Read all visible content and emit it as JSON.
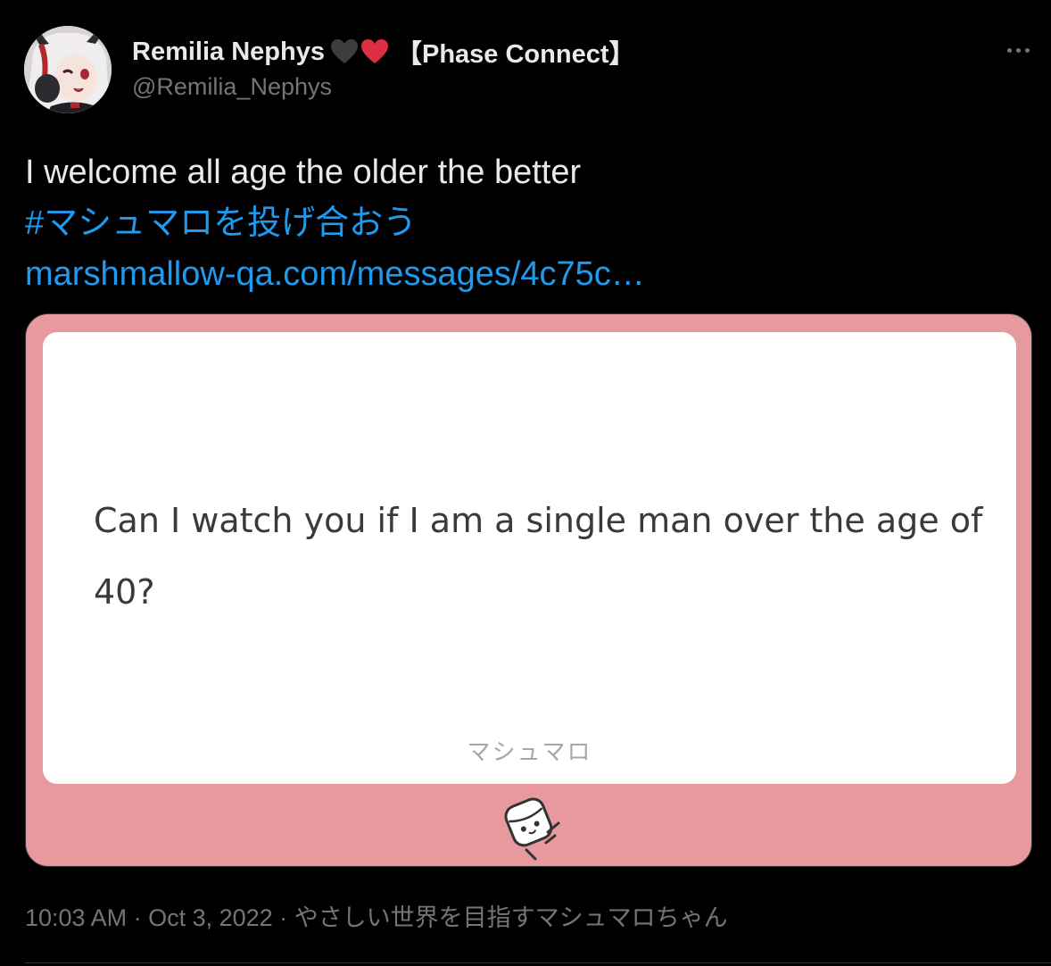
{
  "author": {
    "display_name": "Remilia Nephys",
    "badge_emojis": [
      "black-heart-icon",
      "red-heart-icon"
    ],
    "tag": "【Phase Connect】",
    "handle": "@Remilia_Nephys"
  },
  "tweet": {
    "text": "I welcome all age the older the better",
    "hashtag": "#マシュマロを投げ合おう",
    "link": "marshmallow-qa.com/messages/4c75c…"
  },
  "card": {
    "question": "Can I watch you if I am a single man over the age of 40?",
    "brand_label": "マシュマロ",
    "mascot_icon": "marshmallow-mascot-icon",
    "frame_color": "#e7999d"
  },
  "meta": {
    "time": "10:03 AM",
    "date": "Oct 3, 2022",
    "source": "やさしい世界を目指すマシュマロちゃん",
    "separator": " · "
  },
  "colors": {
    "background": "#000000",
    "text": "#e7e9ea",
    "secondary": "#71767b",
    "link": "#1d9bf0"
  }
}
